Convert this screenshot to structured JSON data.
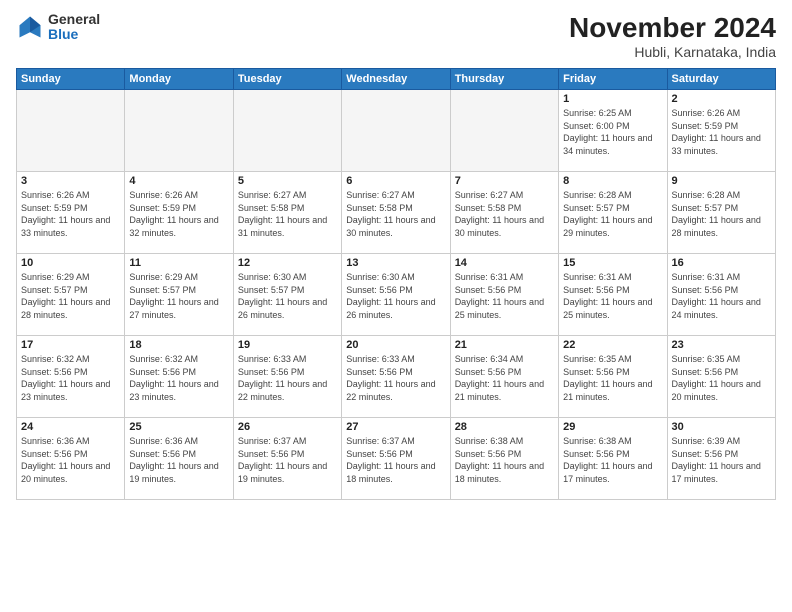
{
  "logo": {
    "general": "General",
    "blue": "Blue"
  },
  "title": "November 2024",
  "location": "Hubli, Karnataka, India",
  "days_of_week": [
    "Sunday",
    "Monday",
    "Tuesday",
    "Wednesday",
    "Thursday",
    "Friday",
    "Saturday"
  ],
  "weeks": [
    [
      {
        "day": "",
        "info": ""
      },
      {
        "day": "",
        "info": ""
      },
      {
        "day": "",
        "info": ""
      },
      {
        "day": "",
        "info": ""
      },
      {
        "day": "",
        "info": ""
      },
      {
        "day": "1",
        "info": "Sunrise: 6:25 AM\nSunset: 6:00 PM\nDaylight: 11 hours and 34 minutes."
      },
      {
        "day": "2",
        "info": "Sunrise: 6:26 AM\nSunset: 5:59 PM\nDaylight: 11 hours and 33 minutes."
      }
    ],
    [
      {
        "day": "3",
        "info": "Sunrise: 6:26 AM\nSunset: 5:59 PM\nDaylight: 11 hours and 33 minutes."
      },
      {
        "day": "4",
        "info": "Sunrise: 6:26 AM\nSunset: 5:59 PM\nDaylight: 11 hours and 32 minutes."
      },
      {
        "day": "5",
        "info": "Sunrise: 6:27 AM\nSunset: 5:58 PM\nDaylight: 11 hours and 31 minutes."
      },
      {
        "day": "6",
        "info": "Sunrise: 6:27 AM\nSunset: 5:58 PM\nDaylight: 11 hours and 30 minutes."
      },
      {
        "day": "7",
        "info": "Sunrise: 6:27 AM\nSunset: 5:58 PM\nDaylight: 11 hours and 30 minutes."
      },
      {
        "day": "8",
        "info": "Sunrise: 6:28 AM\nSunset: 5:57 PM\nDaylight: 11 hours and 29 minutes."
      },
      {
        "day": "9",
        "info": "Sunrise: 6:28 AM\nSunset: 5:57 PM\nDaylight: 11 hours and 28 minutes."
      }
    ],
    [
      {
        "day": "10",
        "info": "Sunrise: 6:29 AM\nSunset: 5:57 PM\nDaylight: 11 hours and 28 minutes."
      },
      {
        "day": "11",
        "info": "Sunrise: 6:29 AM\nSunset: 5:57 PM\nDaylight: 11 hours and 27 minutes."
      },
      {
        "day": "12",
        "info": "Sunrise: 6:30 AM\nSunset: 5:57 PM\nDaylight: 11 hours and 26 minutes."
      },
      {
        "day": "13",
        "info": "Sunrise: 6:30 AM\nSunset: 5:56 PM\nDaylight: 11 hours and 26 minutes."
      },
      {
        "day": "14",
        "info": "Sunrise: 6:31 AM\nSunset: 5:56 PM\nDaylight: 11 hours and 25 minutes."
      },
      {
        "day": "15",
        "info": "Sunrise: 6:31 AM\nSunset: 5:56 PM\nDaylight: 11 hours and 25 minutes."
      },
      {
        "day": "16",
        "info": "Sunrise: 6:31 AM\nSunset: 5:56 PM\nDaylight: 11 hours and 24 minutes."
      }
    ],
    [
      {
        "day": "17",
        "info": "Sunrise: 6:32 AM\nSunset: 5:56 PM\nDaylight: 11 hours and 23 minutes."
      },
      {
        "day": "18",
        "info": "Sunrise: 6:32 AM\nSunset: 5:56 PM\nDaylight: 11 hours and 23 minutes."
      },
      {
        "day": "19",
        "info": "Sunrise: 6:33 AM\nSunset: 5:56 PM\nDaylight: 11 hours and 22 minutes."
      },
      {
        "day": "20",
        "info": "Sunrise: 6:33 AM\nSunset: 5:56 PM\nDaylight: 11 hours and 22 minutes."
      },
      {
        "day": "21",
        "info": "Sunrise: 6:34 AM\nSunset: 5:56 PM\nDaylight: 11 hours and 21 minutes."
      },
      {
        "day": "22",
        "info": "Sunrise: 6:35 AM\nSunset: 5:56 PM\nDaylight: 11 hours and 21 minutes."
      },
      {
        "day": "23",
        "info": "Sunrise: 6:35 AM\nSunset: 5:56 PM\nDaylight: 11 hours and 20 minutes."
      }
    ],
    [
      {
        "day": "24",
        "info": "Sunrise: 6:36 AM\nSunset: 5:56 PM\nDaylight: 11 hours and 20 minutes."
      },
      {
        "day": "25",
        "info": "Sunrise: 6:36 AM\nSunset: 5:56 PM\nDaylight: 11 hours and 19 minutes."
      },
      {
        "day": "26",
        "info": "Sunrise: 6:37 AM\nSunset: 5:56 PM\nDaylight: 11 hours and 19 minutes."
      },
      {
        "day": "27",
        "info": "Sunrise: 6:37 AM\nSunset: 5:56 PM\nDaylight: 11 hours and 18 minutes."
      },
      {
        "day": "28",
        "info": "Sunrise: 6:38 AM\nSunset: 5:56 PM\nDaylight: 11 hours and 18 minutes."
      },
      {
        "day": "29",
        "info": "Sunrise: 6:38 AM\nSunset: 5:56 PM\nDaylight: 11 hours and 17 minutes."
      },
      {
        "day": "30",
        "info": "Sunrise: 6:39 AM\nSunset: 5:56 PM\nDaylight: 11 hours and 17 minutes."
      }
    ]
  ]
}
